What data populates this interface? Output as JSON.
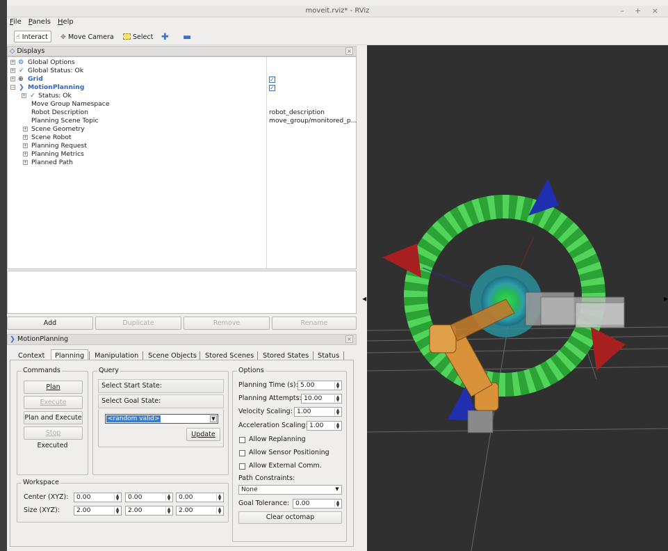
{
  "window": {
    "title": "moveit.rviz* - RViz",
    "controls": "– + ×"
  },
  "menu": [
    "File",
    "Panels",
    "Help"
  ],
  "toolbar": {
    "interact": "Interact",
    "move_camera": "Move Camera",
    "select": "Select"
  },
  "displays": {
    "header": "Displays",
    "rows": {
      "global_options": "Global Options",
      "global_status": "Global Status: Ok",
      "grid": "Grid",
      "motion_planning": "MotionPlanning",
      "status": "Status: Ok",
      "move_group_ns": "Move Group Namespace",
      "robot_description": "Robot Description",
      "planning_scene_topic": "Planning Scene Topic",
      "scene_geometry": "Scene Geometry",
      "scene_robot": "Scene Robot",
      "planning_request": "Planning Request",
      "planning_metrics": "Planning Metrics",
      "planned_path": "Planned Path"
    },
    "values": {
      "robot_description": "robot_description",
      "planning_scene_topic": "move_group/monitored_p..."
    },
    "buttons": {
      "add": "Add",
      "duplicate": "Duplicate",
      "remove": "Remove",
      "rename": "Rename"
    }
  },
  "motion_panel": {
    "header": "MotionPlanning",
    "tabs": [
      "Context",
      "Planning",
      "Manipulation",
      "Scene Objects",
      "Stored Scenes",
      "Stored States",
      "Status"
    ],
    "commands": {
      "label": "Commands",
      "plan": "Plan",
      "execute": "Execute",
      "plan_execute": "Plan and Execute",
      "stop": "Stop",
      "status": "Executed"
    },
    "query": {
      "label": "Query",
      "start": "Select Start State:",
      "goal": "Select Goal State:",
      "combo": "<random valid>",
      "update": "Update"
    },
    "options": {
      "label": "Options",
      "planning_time_label": "Planning Time (s):",
      "planning_time": "5.00",
      "planning_attempts_label": "Planning Attempts:",
      "planning_attempts": "10.00",
      "velocity_label": "Velocity Scaling:",
      "velocity": "1.00",
      "accel_label": "Acceleration Scaling:",
      "accel": "1.00",
      "allow_replanning": "Allow Replanning",
      "allow_sensor": "Allow Sensor Positioning",
      "allow_external": "Allow External Comm.",
      "path_constraints_label": "Path Constraints:",
      "path_constraints": "None",
      "goal_tolerance_label": "Goal Tolerance:",
      "goal_tolerance": "0.00",
      "clear_octomap": "Clear octomap"
    },
    "workspace": {
      "label": "Workspace",
      "center_label": "Center (XYZ):",
      "center": [
        "0.00",
        "0.00",
        "0.00"
      ],
      "size_label": "Size (XYZ):",
      "size": [
        "2.00",
        "2.00",
        "2.00"
      ]
    }
  },
  "colors": {
    "viewport_bg": "#303030",
    "ring_green": "#33b83a",
    "arrow_blue": "#1f2fb0",
    "arrow_red": "#a81f1f",
    "robot_orange": "#d9923a",
    "selected_blue": "#3d7bcb"
  }
}
